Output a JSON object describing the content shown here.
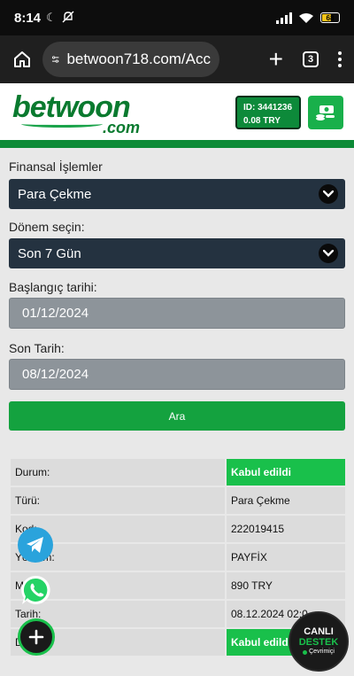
{
  "status_bar": {
    "time": "8:14",
    "battery": "68"
  },
  "browser": {
    "url": "betwoon718.com/Acc",
    "tab_count": "3"
  },
  "header": {
    "logo_text": "betwoon",
    "logo_suffix": ".com",
    "account_id": "ID: 3441236",
    "balance": "0.08 TRY"
  },
  "form": {
    "transactions_label": "Finansal İşlemler",
    "transactions_value": "Para Çekme",
    "period_label": "Dönem seçin:",
    "period_value": "Son 7 Gün",
    "start_label": "Başlangıç tarihi:",
    "start_value": "01/12/2024",
    "end_label": "Son Tarih:",
    "end_value": "08/12/2024",
    "search_button": "Ara"
  },
  "table": {
    "rows": [
      {
        "key": "Durum:",
        "value": "Kabul edildi",
        "highlight": true
      },
      {
        "key": "Türü:",
        "value": "Para Çekme"
      },
      {
        "key": "Kod:",
        "value": "222019415"
      },
      {
        "key": "Yöntem:",
        "value": "PAYFİX"
      },
      {
        "key": "Miktar:",
        "value": "890 TRY"
      },
      {
        "key": "Tarih:",
        "value": "08.12.2024 02:0"
      },
      {
        "key": "Durum:",
        "value": "Kabul edildi",
        "highlight": true
      }
    ]
  },
  "support": {
    "line1": "CANLI",
    "line2": "DESTEK",
    "line3": "Çevrimiçi"
  },
  "colors": {
    "brand_green": "#0c8a36",
    "accept_green": "#19c04b",
    "select_dark": "#243240"
  }
}
